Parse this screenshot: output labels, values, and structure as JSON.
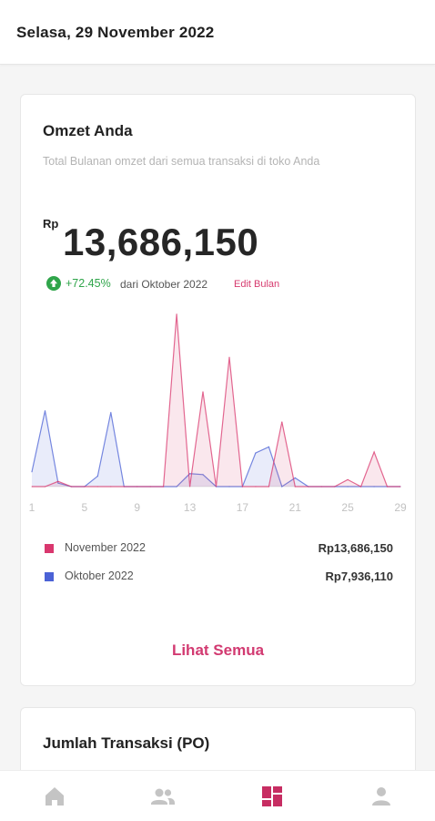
{
  "header": {
    "date": "Selasa, 29 November 2022"
  },
  "omzet_card": {
    "title": "Omzet Anda",
    "subtitle": "Total Bulanan omzet dari semua transaksi di toko Anda",
    "currency": "Rp",
    "total": "13,686,150",
    "growth_value": "+72.45%",
    "growth_text": "dari Oktober 2022",
    "edit_label": "Edit Bulan",
    "legend": [
      {
        "label": "November 2022",
        "value": "Rp13,686,150",
        "color": "#d9376e"
      },
      {
        "label": "Oktober 2022",
        "value": "Rp7,936,110",
        "color": "#4b62d6"
      }
    ],
    "see_all_label": "Lihat Semua"
  },
  "transaksi_card": {
    "title": "Jumlah Transaksi (PO)"
  },
  "bottom_nav": {
    "items": [
      {
        "icon": "home-icon",
        "active": false
      },
      {
        "icon": "users-icon",
        "active": false
      },
      {
        "icon": "dashboard-icon",
        "active": true
      },
      {
        "icon": "profile-icon",
        "active": false
      }
    ],
    "active_color": "#c72d62",
    "inactive_color": "#c4c4c4"
  },
  "chart_data": {
    "type": "area",
    "x": [
      1,
      2,
      3,
      4,
      5,
      6,
      7,
      8,
      9,
      10,
      11,
      12,
      13,
      14,
      15,
      16,
      17,
      18,
      19,
      20,
      21,
      22,
      23,
      24,
      25,
      26,
      27,
      28,
      29
    ],
    "x_ticks": [
      1,
      5,
      9,
      13,
      17,
      21,
      25,
      29
    ],
    "series": [
      {
        "name": "November 2022",
        "color": "#d9376e",
        "values": [
          0,
          0,
          0.6,
          0,
          0,
          0,
          0,
          0,
          0,
          0,
          0,
          20,
          0,
          11,
          0,
          15,
          0,
          0,
          0,
          7.5,
          0,
          0,
          0,
          0,
          0.8,
          0,
          4,
          0,
          0
        ]
      },
      {
        "name": "Oktober 2022",
        "color": "#4b62d6",
        "values": [
          1.7,
          8.8,
          0.4,
          0,
          0,
          1.2,
          8.6,
          0,
          0,
          0,
          0,
          0,
          1.5,
          1.4,
          0,
          0,
          0,
          3.9,
          4.6,
          0,
          1,
          0,
          0,
          0,
          0,
          0,
          0,
          0,
          0
        ]
      }
    ],
    "ylim": [
      0,
      20.5
    ],
    "grid": false
  }
}
